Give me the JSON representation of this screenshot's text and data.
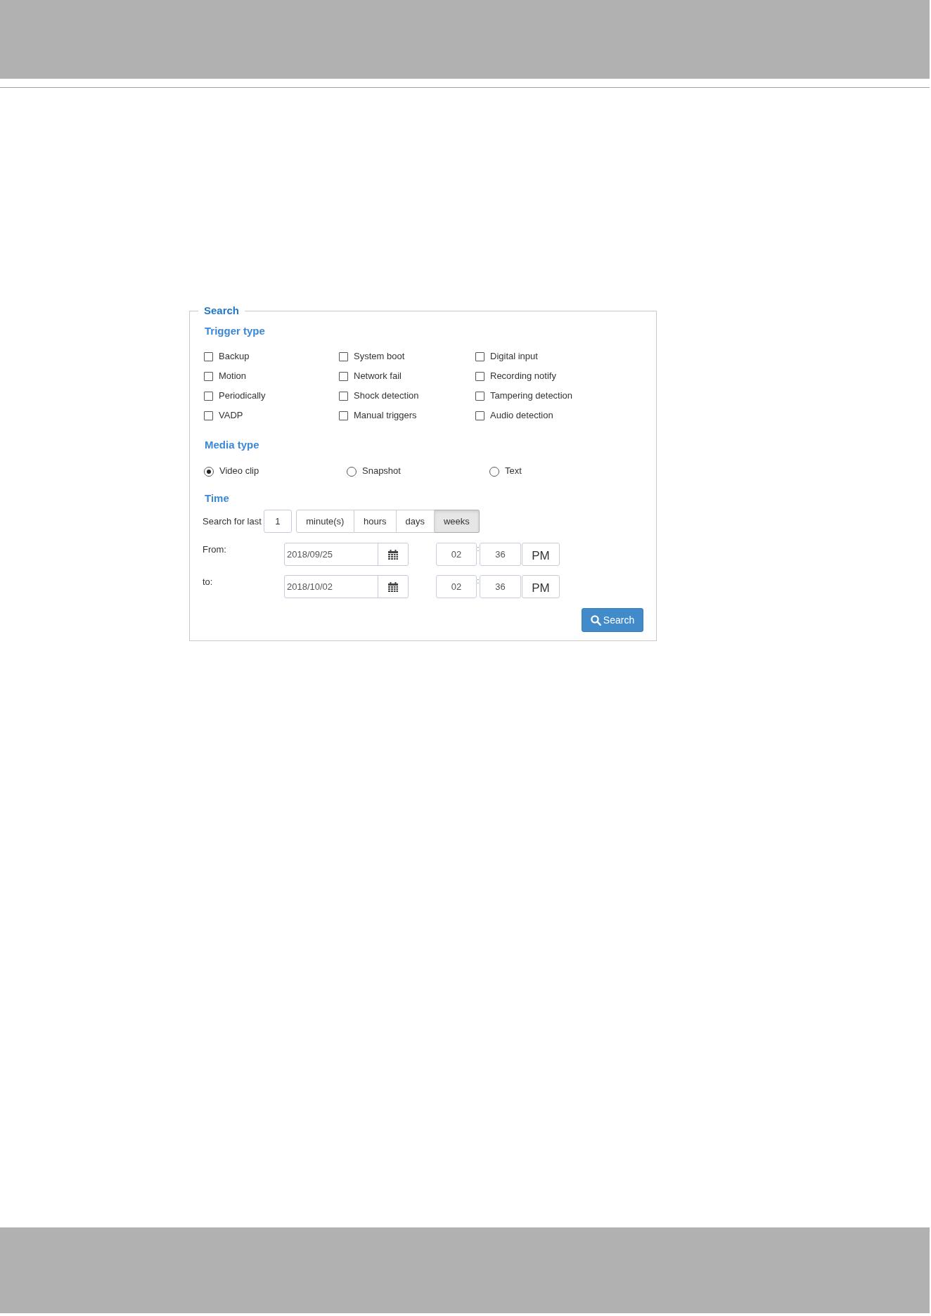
{
  "panel": {
    "legend": "Search",
    "trigger_type": {
      "heading": "Trigger type",
      "options": [
        {
          "label": "Backup",
          "checked": false
        },
        {
          "label": "System boot",
          "checked": false
        },
        {
          "label": "Digital input",
          "checked": false
        },
        {
          "label": "Motion",
          "checked": false
        },
        {
          "label": "Network fail",
          "checked": false
        },
        {
          "label": "Recording notify",
          "checked": false
        },
        {
          "label": "Periodically",
          "checked": false
        },
        {
          "label": "Shock detection",
          "checked": false
        },
        {
          "label": "Tampering detection",
          "checked": false
        },
        {
          "label": "VADP",
          "checked": false
        },
        {
          "label": "Manual triggers",
          "checked": false
        },
        {
          "label": "Audio detection",
          "checked": false
        }
      ]
    },
    "media_type": {
      "heading": "Media type",
      "options": [
        {
          "label": "Video clip",
          "selected": true
        },
        {
          "label": "Snapshot",
          "selected": false
        },
        {
          "label": "Text",
          "selected": false
        }
      ]
    },
    "time": {
      "heading": "Time",
      "search_for_last": {
        "label": "Search for last",
        "value": "1",
        "units": [
          {
            "label": "minute(s)",
            "selected": false
          },
          {
            "label": "hours",
            "selected": false
          },
          {
            "label": "days",
            "selected": false
          },
          {
            "label": "weeks",
            "selected": true
          }
        ]
      },
      "ranges": [
        {
          "label": "From:",
          "date": "2018/09/25",
          "hour": "02",
          "separator": ":",
          "minute": "36",
          "meridiem": "PM"
        },
        {
          "label": "to:",
          "date": "2018/10/02",
          "hour": "02",
          "separator": ":",
          "minute": "36",
          "meridiem": "PM"
        }
      ]
    },
    "search_button": "Search"
  }
}
